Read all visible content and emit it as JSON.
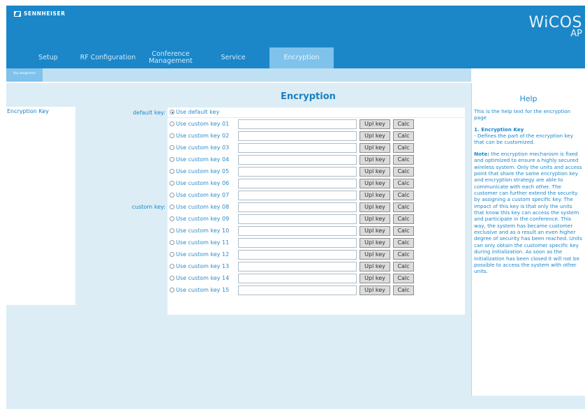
{
  "brand": {
    "name": "SENNHEISER"
  },
  "product": {
    "name": "WiCOS",
    "sub": "AP"
  },
  "nav": [
    {
      "label": "Setup"
    },
    {
      "label": "RF Configuration"
    },
    {
      "label": "Conference Management"
    },
    {
      "label": "Service"
    },
    {
      "label": "Encryption",
      "active": true
    }
  ],
  "subtab": {
    "label": "Key assignment"
  },
  "page_title": "Encryption",
  "left_nav": {
    "item": "Encryption Key"
  },
  "form": {
    "default_label": "default key:",
    "custom_label": "custom key:",
    "default_option": "Use default key",
    "default_selected": true,
    "upload_label": "Upl key",
    "calc_label": "Calc",
    "keys": [
      {
        "label": "Use custom key 01",
        "value": ""
      },
      {
        "label": "Use custom key 02",
        "value": ""
      },
      {
        "label": "Use custom key 03",
        "value": ""
      },
      {
        "label": "Use custom key 04",
        "value": ""
      },
      {
        "label": "Use custom key 05",
        "value": ""
      },
      {
        "label": "Use custom key 06",
        "value": ""
      },
      {
        "label": "Use custom key 07",
        "value": ""
      },
      {
        "label": "Use custom key 08",
        "value": ""
      },
      {
        "label": "Use custom key 09",
        "value": ""
      },
      {
        "label": "Use custom key 10",
        "value": ""
      },
      {
        "label": "Use custom key 11",
        "value": ""
      },
      {
        "label": "Use custom key 12",
        "value": ""
      },
      {
        "label": "Use custom key 13",
        "value": ""
      },
      {
        "label": "Use custom key 14",
        "value": ""
      },
      {
        "label": "Use custom key 15",
        "value": ""
      }
    ]
  },
  "help": {
    "title": "Help",
    "intro": "This is the help text for the encryption page",
    "section_heading": "1. Encryption Key",
    "section_text": "- Defines the part of the encryption key that can be customized.",
    "note_label": "Note:",
    "note_text": " the encryption mechanism is fixed and optimized to ensure a highly secured wireless system. Only the units and access point that share the same encryption key and encryption strategy are able to communicate with each other. The customer can further extend the security by assigning a custom specific key. The impact of this key is that only the units that know this key can access the system and participate in the conference. This way, the system has became customer exclusive and as a result an even higher degree of security has been reached. Units can only obtain the customer specific key during initialization. As soon as the initialization has been closed it will not be possible to access the system with other units."
  },
  "colors": {
    "header": "#1b87c9",
    "active_tab": "#7fc2ec",
    "content_bg": "#dcedf6",
    "text_blue": "#1b87c9"
  }
}
